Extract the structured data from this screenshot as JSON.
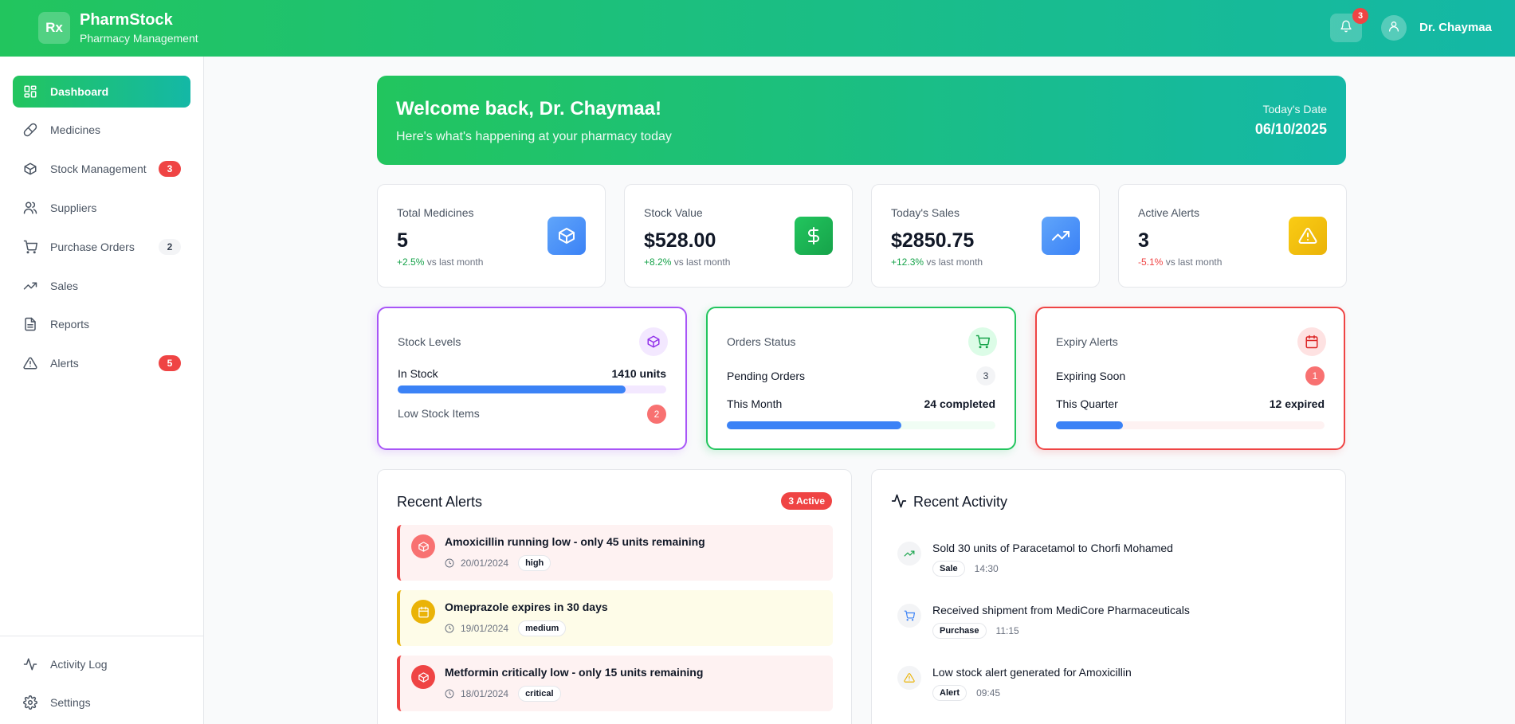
{
  "header": {
    "logo_text": "Rx",
    "brand_name": "PharmStock",
    "brand_subtitle": "Pharmacy Management",
    "notification_count": "3",
    "user_name": "Dr. Chaymaa"
  },
  "sidebar": {
    "items": [
      {
        "label": "Dashboard",
        "icon": "dashboard-icon",
        "active": true
      },
      {
        "label": "Medicines",
        "icon": "pill-icon"
      },
      {
        "label": "Stock Management",
        "icon": "package-icon",
        "badge": "3"
      },
      {
        "label": "Suppliers",
        "icon": "users-icon"
      },
      {
        "label": "Purchase Orders",
        "icon": "cart-icon",
        "badge": "2"
      },
      {
        "label": "Sales",
        "icon": "trending-up-icon"
      },
      {
        "label": "Reports",
        "icon": "file-text-icon"
      },
      {
        "label": "Alerts",
        "icon": "alert-triangle-icon",
        "badge": "5"
      }
    ],
    "bottom_items": [
      {
        "label": "Activity Log",
        "icon": "activity-icon"
      },
      {
        "label": "Settings",
        "icon": "settings-icon"
      }
    ]
  },
  "welcome": {
    "title": "Welcome back, Dr. Chaymaa!",
    "subtitle": "Here's what's happening at your pharmacy today",
    "date_label": "Today's Date",
    "date_value": "06/10/2025"
  },
  "stats": [
    {
      "title": "Total Medicines",
      "value": "5",
      "change": "+2.5%",
      "change_suffix": "vs last month",
      "trend": "up",
      "icon": "package-icon",
      "color": "#3b82f6"
    },
    {
      "title": "Stock Value",
      "value": "$528.00",
      "change": "+8.2%",
      "change_suffix": "vs last month",
      "trend": "up",
      "icon": "dollar-icon",
      "color": "#16a34a"
    },
    {
      "title": "Today's Sales",
      "value": "$2850.75",
      "change": "+12.3%",
      "change_suffix": "vs last month",
      "trend": "up",
      "icon": "trending-up-icon",
      "color": "#3b82f6"
    },
    {
      "title": "Active Alerts",
      "value": "3",
      "change": "-5.1%",
      "change_suffix": "vs last month",
      "trend": "down",
      "icon": "alert-triangle-icon",
      "color": "#eab308"
    }
  ],
  "stock_levels": {
    "title": "Stock Levels",
    "in_stock_label": "In Stock",
    "in_stock_value": "1410 units",
    "in_stock_fraction": 0.85,
    "low_stock_label": "Low Stock Items",
    "low_stock_count": "2"
  },
  "orders_status": {
    "title": "Orders Status",
    "pending_label": "Pending Orders",
    "pending_count": "3",
    "month_label": "This Month",
    "month_value": "24 completed",
    "month_fraction": 0.65
  },
  "expiry_alerts": {
    "title": "Expiry Alerts",
    "soon_label": "Expiring Soon",
    "soon_count": "1",
    "quarter_label": "This Quarter",
    "quarter_value": "12 expired",
    "quarter_fraction": 0.25
  },
  "recent_alerts": {
    "title": "Recent Alerts",
    "badge": "3 Active",
    "items": [
      {
        "message": "Amoxicillin running low - only 45 units remaining",
        "date": "20/01/2024",
        "severity": "high",
        "icon": "package-icon",
        "kind": "low"
      },
      {
        "message": "Omeprazole expires in 30 days",
        "date": "19/01/2024",
        "severity": "medium",
        "icon": "calendar-icon",
        "kind": "med"
      },
      {
        "message": "Metformin critically low - only 15 units remaining",
        "date": "18/01/2024",
        "severity": "critical",
        "icon": "package-icon",
        "kind": "low"
      }
    ]
  },
  "recent_activity": {
    "title": "Recent Activity",
    "items": [
      {
        "message": "Sold 30 units of Paracetamol to Chorfi Mohamed",
        "tag": "Sale",
        "time": "14:30",
        "icon": "trending-up-icon"
      },
      {
        "message": "Received shipment from MediCore Pharmaceuticals",
        "tag": "Purchase",
        "time": "11:15",
        "icon": "cart-icon"
      },
      {
        "message": "Low stock alert generated for Amoxicillin",
        "tag": "Alert",
        "time": "09:45",
        "icon": "alert-triangle-icon"
      }
    ]
  }
}
